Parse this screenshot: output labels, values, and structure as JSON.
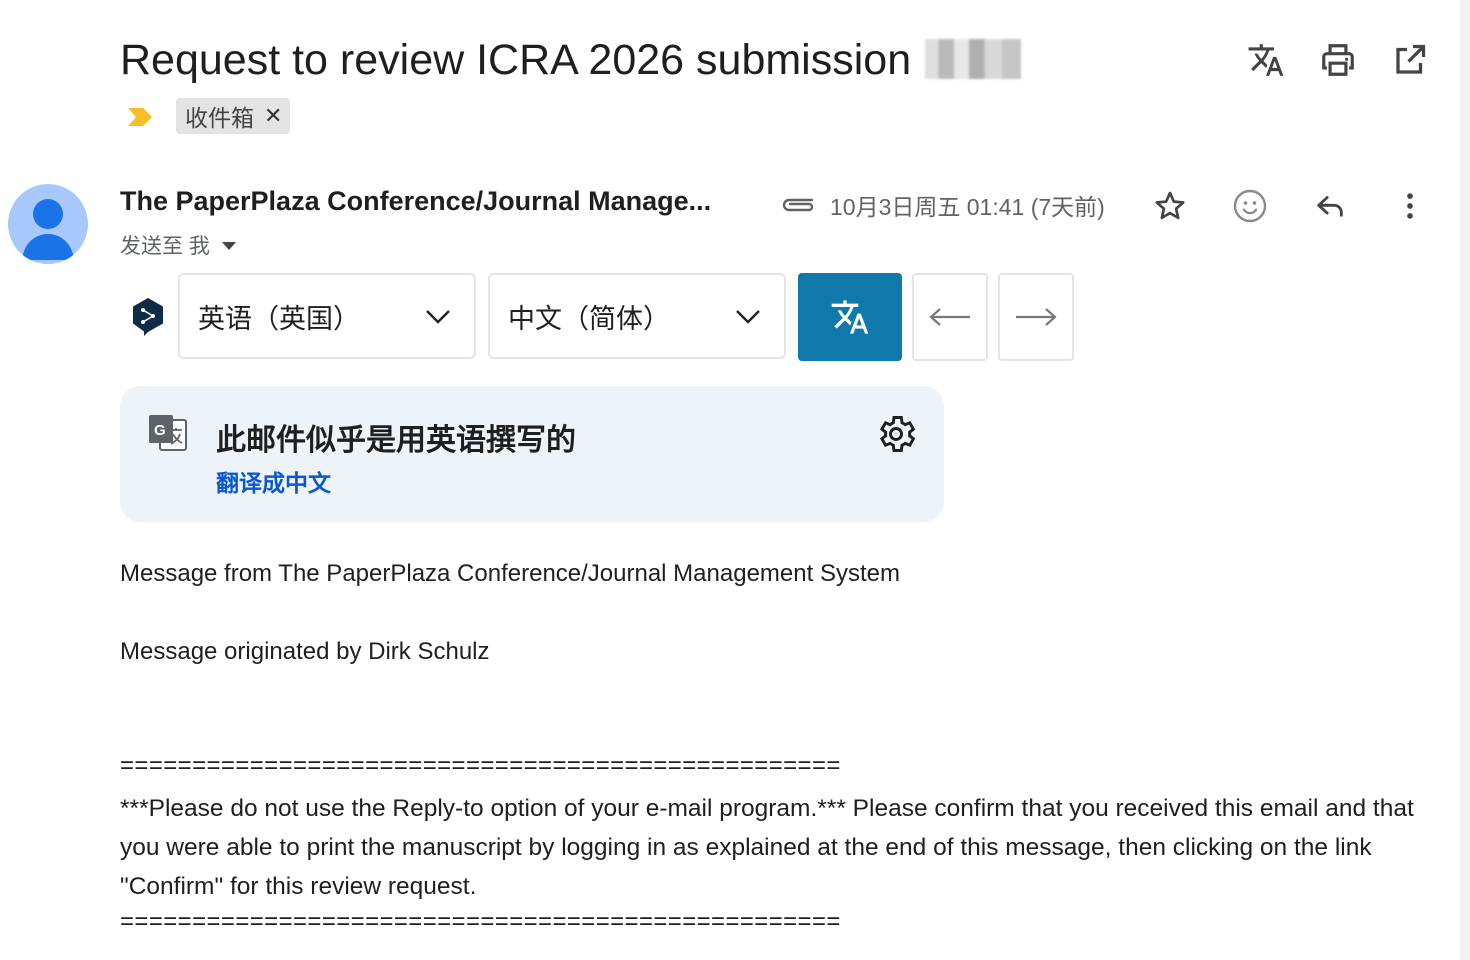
{
  "email": {
    "subject": "Request to review ICRA 2026 submission",
    "label": "收件箱",
    "sender": "The PaperPlaza Conference/Journal Manage...",
    "sent_to": "发送至 我",
    "date": "10月3日周五 01:41 (7天前)"
  },
  "icons": {
    "top": [
      "translate-icon",
      "print-icon",
      "open-in-new-icon"
    ],
    "row": [
      "star-icon",
      "emoji-icon",
      "reply-icon",
      "more-vert-icon"
    ]
  },
  "translator": {
    "source_lang": "英语（英国）",
    "target_lang": "中文（简体）",
    "accent": "#0f79ab"
  },
  "banner": {
    "title": "此邮件似乎是用英语撰写的",
    "link": "翻译成中文"
  },
  "body": {
    "line1": "Message from The PaperPlaza Conference/Journal Management System",
    "line2": "Message originated by Dirk Schulz",
    "separator": "==================================================",
    "paragraph": "***Please do not use the Reply-to option of your e-mail program.*** Please confirm that you received this email and that you were able to print the manuscript by logging in as explained at the end of this message, then clicking on the link \"Confirm\" for this review request."
  }
}
